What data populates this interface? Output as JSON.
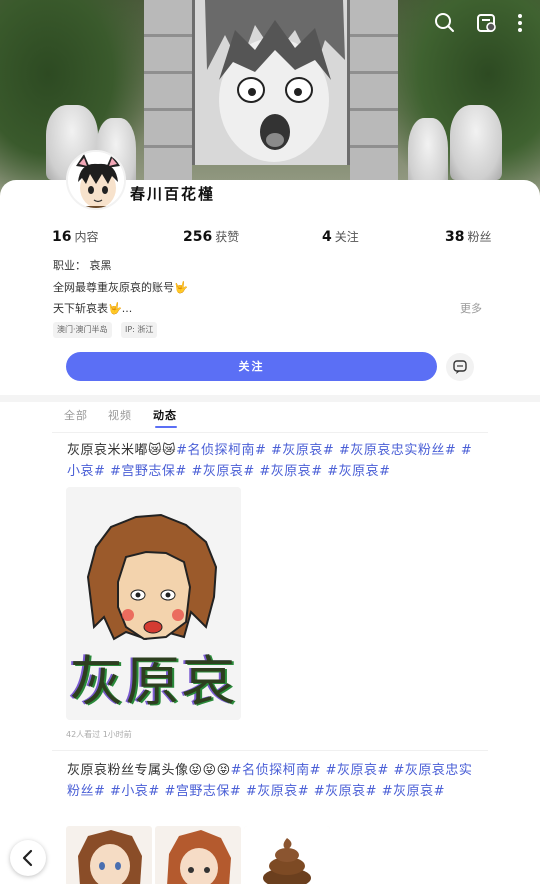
{
  "header": {
    "icons": [
      "search-icon",
      "profile-card-icon",
      "more-icon"
    ]
  },
  "profile": {
    "nickname": "春川百花槿",
    "stats": [
      {
        "value": "16",
        "label": "内容"
      },
      {
        "value": "256",
        "label": "获赞"
      },
      {
        "value": "4",
        "label": "关注"
      },
      {
        "value": "38",
        "label": "粉丝"
      }
    ],
    "bio": [
      "职业：  哀黑",
      "全网最尊重灰原哀的账号🤟",
      "天下斩哀表🤟..."
    ],
    "more_label": "更多",
    "tags": [
      "澳门·澳门半岛",
      "IP: 浙江"
    ],
    "follow_label": "关注"
  },
  "tabs": [
    {
      "label": "全部",
      "active": false
    },
    {
      "label": "视频",
      "active": false
    },
    {
      "label": "动态",
      "active": true
    }
  ],
  "posts": [
    {
      "text": "灰原哀米米嘟😿😿",
      "hashtags": "#名侦探柯南# #灰原哀# #灰原哀忠实粉丝# #小哀# #宫野志保# #灰原哀# #灰原哀# #灰原哀#",
      "image_caption": "灰原哀",
      "meta": "42人看过  1小时前"
    },
    {
      "text": "灰原哀粉丝专属头像😝😝😝",
      "hashtags": "#名侦探柯南# #灰原哀# #灰原哀忠实粉丝# #小哀# #宫野志保# #灰原哀# #灰原哀# #灰原哀#"
    }
  ],
  "colors": {
    "accent": "#5b6ff5",
    "hashtag": "#4a5fd6"
  }
}
